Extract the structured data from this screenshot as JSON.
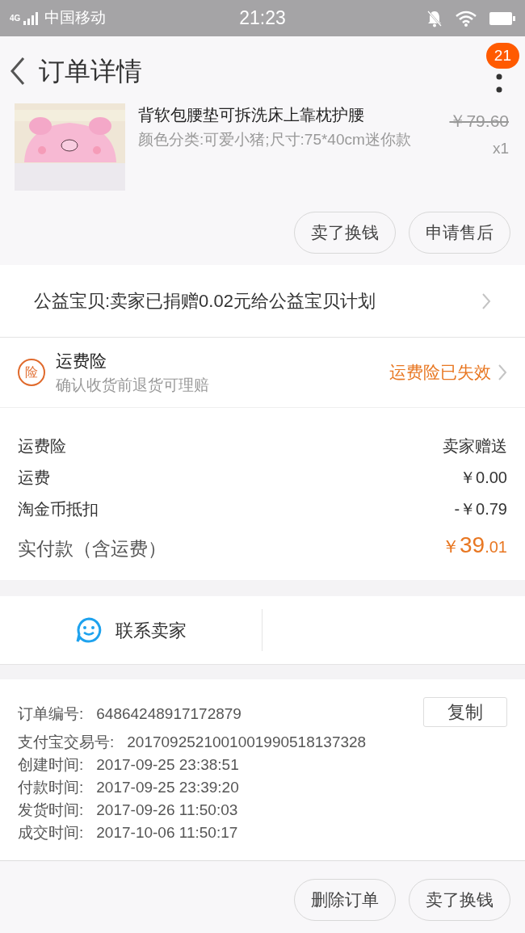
{
  "status_bar": {
    "network": "4G",
    "carrier": "中国移动",
    "time": "21:23"
  },
  "header": {
    "title": "订单详情",
    "badge": "21"
  },
  "product": {
    "title": "背软包腰垫可拆洗床上靠枕护腰",
    "sku": "颜色分类:可爱小猪;尺寸:75*40cm迷你款",
    "price": "￥79.60",
    "quantity": "x1",
    "buttons": [
      "卖了换钱",
      "申请售后"
    ]
  },
  "charity": {
    "text": "公益宝贝:卖家已捐赠0.02元给公益宝贝计划"
  },
  "insurance": {
    "badge": "险",
    "title": "运费险",
    "subtitle": "确认收货前退货可理赔",
    "status": "运费险已失效"
  },
  "fees": [
    {
      "label": "运费险",
      "value": "卖家赠送"
    },
    {
      "label": "运费",
      "value": "￥0.00"
    },
    {
      "label": "淘金币抵扣",
      "value": "-￥0.79"
    }
  ],
  "total": {
    "label": "实付款（含运费）",
    "currency": "￥",
    "integer": "39",
    "decimal": ".01"
  },
  "contact": {
    "label": "联系卖家"
  },
  "order_info": {
    "copy_button": "复制",
    "rows": [
      {
        "label": "订单编号:",
        "value": "64864248917172879"
      },
      {
        "label": "支付宝交易号:",
        "value": "2017092521001001990518137328"
      },
      {
        "label": "创建时间:",
        "value": "2017-09-25 23:38:51"
      },
      {
        "label": "付款时间:",
        "value": "2017-09-25 23:39:20"
      },
      {
        "label": "发货时间:",
        "value": "2017-09-26 11:50:03"
      },
      {
        "label": "成交时间:",
        "value": "2017-10-06 11:50:17"
      }
    ]
  },
  "bottom_buttons": [
    "删除订单",
    "卖了换钱"
  ]
}
